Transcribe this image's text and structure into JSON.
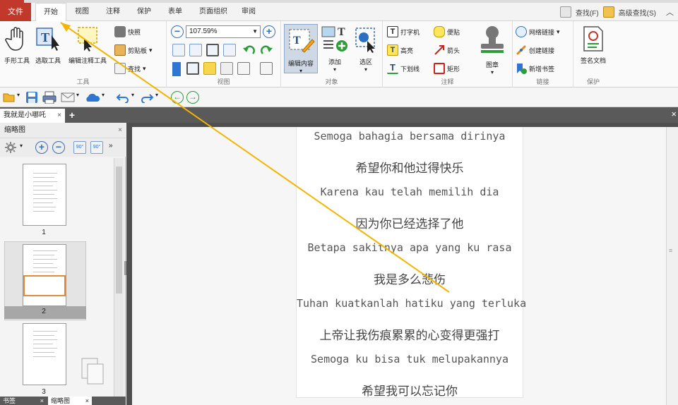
{
  "menu": {
    "file": "文件",
    "tabs": [
      "开始",
      "视图",
      "注释",
      "保护",
      "表单",
      "页面组织",
      "审阅"
    ],
    "active": "开始",
    "find": "查找(F)",
    "advanced_find": "高级查找(S)"
  },
  "ribbon": {
    "tools": {
      "label": "工具",
      "hand": "手形工具",
      "select_text": "选取工具",
      "edit_annot": "编辑注释工具",
      "snapshot": "快照",
      "clipboard": "剪贴板",
      "find": "查找"
    },
    "view": {
      "label": "视图",
      "zoom": "107.59%"
    },
    "object": {
      "label": "对象",
      "edit_content": "编辑内容",
      "add": "添加",
      "select_area": "选区"
    },
    "comment": {
      "label": "注释",
      "typewriter": "打字机",
      "note": "便贴",
      "highlight": "高亮",
      "arrow": "箭头",
      "underline": "下划线",
      "rectangle": "矩形",
      "stamp": "图章"
    },
    "link": {
      "label": "链接",
      "web_link": "网络链接",
      "create_link": "创建链接",
      "add_bookmark": "新增书签"
    },
    "protect": {
      "label": "保护",
      "sign": "签名文档"
    }
  },
  "document_tab": {
    "name": "我就是小哪吒",
    "close": "×",
    "add": "+"
  },
  "thumbnail_panel": {
    "title": "缩略图",
    "close": "×",
    "pages": [
      "1",
      "2",
      "3"
    ],
    "selected": "2"
  },
  "bottom_tabs": {
    "bookmarks": "书签",
    "thumbnails": "缩略图",
    "close": "×"
  },
  "page_lines": [
    {
      "text": "Semoga bahagia bersama dirinya",
      "kind": "latin"
    },
    {
      "text": "希望你和他过得快乐",
      "kind": "cjk"
    },
    {
      "text": "Karena kau telah memilih dia",
      "kind": "latin"
    },
    {
      "text": "因为你已经选择了他",
      "kind": "cjk"
    },
    {
      "text": "Betapa sakitnya apa yang ku rasa",
      "kind": "latin"
    },
    {
      "text": "我是多么悲伤",
      "kind": "cjk"
    },
    {
      "text": "Tuhan kuatkanlah hatiku yang terluka",
      "kind": "latin"
    },
    {
      "text": "上帝让我伤痕累累的心变得更强打",
      "kind": "cjk"
    },
    {
      "text": "Semoga ku bisa tuk melupakannya",
      "kind": "latin"
    },
    {
      "text": "希望我可以忘记你",
      "kind": "cjk"
    }
  ],
  "colors": {
    "accent_red": "#c0392b",
    "annotation_arrow": "#f5b400",
    "selection_orange": "#e48a3c"
  }
}
